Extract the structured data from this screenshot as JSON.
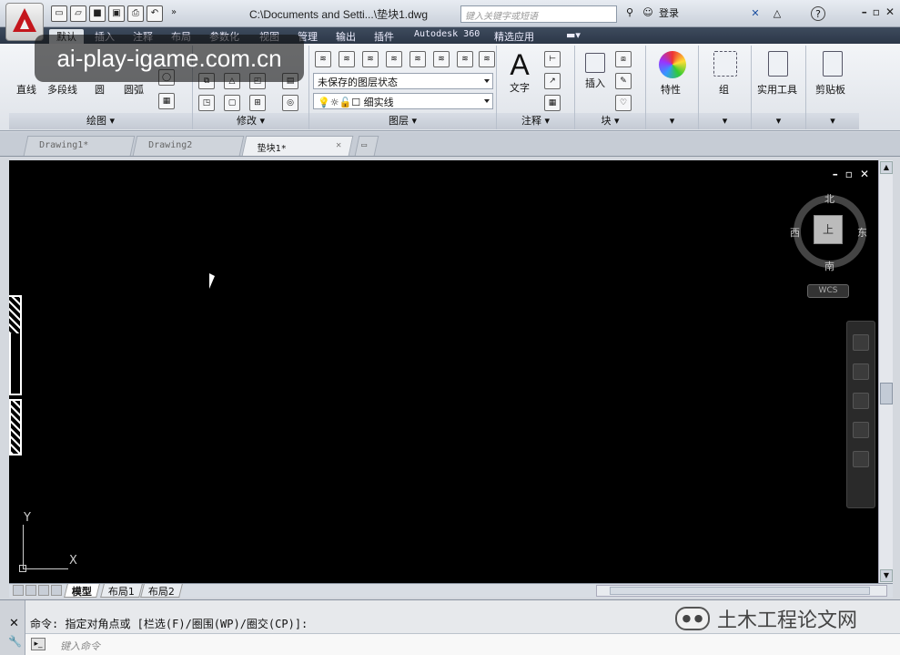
{
  "title_bar": {
    "title": "C:\\Documents and Setti...\\垫块1.dwg",
    "search_placeholder": "键入关键字或短语",
    "login": "登录"
  },
  "ribbon_tabs": [
    "默认",
    "插入",
    "注释",
    "布局",
    "参数化",
    "视图",
    "管理",
    "输出",
    "插件",
    "Autodesk 360",
    "精选应用"
  ],
  "watermark": "ai-play-igame.com.cn",
  "ribbon": {
    "draw": {
      "title": "绘图",
      "line": "直线",
      "polyline": "多段线",
      "circle": "圆",
      "arc": "圆弧"
    },
    "modify": {
      "title": "修改"
    },
    "layers": {
      "title": "图层",
      "state": "未保存的图层状态",
      "current_layer": "细实线"
    },
    "annotation": {
      "title": "注释",
      "text": "文字"
    },
    "block": {
      "title": "块",
      "insert": "插入"
    },
    "properties": {
      "label": "特性"
    },
    "groups": {
      "label": "组"
    },
    "utilities": {
      "label": "实用工具"
    },
    "clipboard": {
      "label": "剪贴板"
    }
  },
  "doc_tabs": [
    {
      "label": "Drawing1*"
    },
    {
      "label": "Drawing2"
    },
    {
      "label": "垫块1*",
      "active": true
    }
  ],
  "viewcube": {
    "north": "北",
    "south": "南",
    "east": "东",
    "west": "西",
    "face": "上",
    "wcs": "WCS"
  },
  "ucs": {
    "x": "X",
    "y": "Y"
  },
  "layout_tabs": [
    "模型",
    "布局1",
    "布局2"
  ],
  "command": {
    "history": "命令: 指定对角点或 [栏选(F)/圈围(WP)/圈交(CP)]:",
    "placeholder": "键入命令"
  },
  "brand": "土木工程论文网"
}
